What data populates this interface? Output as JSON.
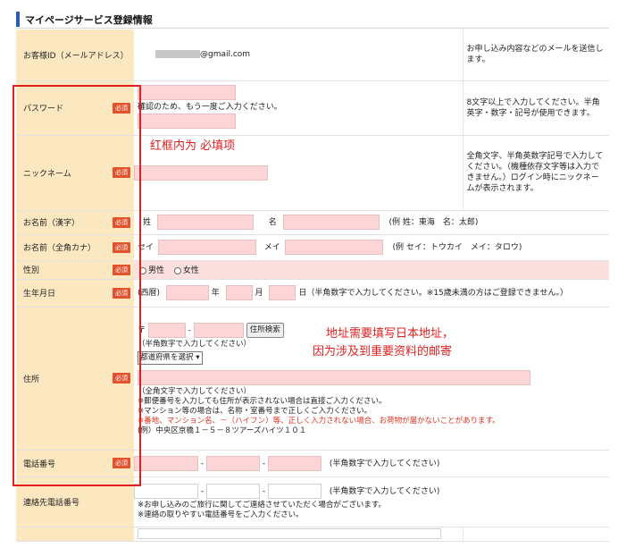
{
  "section_title": "マイページサービス登録情報",
  "required_badge": "必須",
  "rows": {
    "email": {
      "label": "お客様ID（メールアドレス）",
      "value": "@gmail.com",
      "note": "お申し込み内容などのメールを送信します。"
    },
    "password": {
      "label": "パスワード",
      "confirm_text": "確認のため、もう一度ご入力ください。",
      "note": "8文字以上で入力してください。半角英字・数字・記号が使用できます。"
    },
    "nickname": {
      "label": "ニックネーム",
      "note": "全角文字、半角英数字記号で入力してください。（機種依存文字等は入力できません。）ログイン時にニックネームが表示されます。"
    },
    "name_kanji": {
      "label": "お名前（漢字）",
      "sei": "姓",
      "mei": "名",
      "example": "(例 姓：東海　名：太郎)"
    },
    "name_kana": {
      "label": "お名前（全角カナ）",
      "sei": "セイ",
      "mei": "メイ",
      "example": "(例 セイ：トウカイ　メイ：タロウ)"
    },
    "gender": {
      "label": "性別",
      "male": "男性",
      "female": "女性"
    },
    "birthday": {
      "label": "生年月日",
      "era": "(西暦)",
      "year": "年",
      "month": "月",
      "day": "日",
      "hint": "（半角数字で入力してください。※15歳未満の方はご登録できません。）"
    },
    "address": {
      "label": "住所",
      "postal_mark": "〒",
      "dash": "-",
      "search_button": "住所検索",
      "postal_hint": "（半角数字で入力してください）",
      "pref_select": "都道府県を選択",
      "hint1": "（全角文字で入力してください）",
      "hint2": "※郵便番号を入力しても住所が表示されない場合は直接ご入力ください。",
      "hint3": "※マンション等の場合は、名称・室番号まで正しくご入力ください。",
      "hint4_red": "※番地、マンション名、－（ハイフン）等、正しく入力されない場合、お荷物が届かないことがあります。",
      "example": "(例）中央区京橋１－５－８ツアーズハイツ１０１"
    },
    "phone": {
      "label": "電話番号",
      "dash": "-",
      "hint": "(半角数字で入力してください)"
    },
    "contact_phone": {
      "label": "連絡先電話番号",
      "dash": "-",
      "hint": "(半角数字で入力してください)",
      "note1": "※お申し込みのご旅行に関してご連絡させていただく場合がございます。",
      "note2": "※連絡の取りやすい電話番号をご入力ください。"
    }
  },
  "annotations": {
    "required_note": "红框内为 必填项",
    "address_note_line1": "地址需要填写日本地址，",
    "address_note_line2": "因为涉及到重要资料的邮寄"
  },
  "colors": {
    "label_bg": "#fbe8c0",
    "required_input": "#fcd6d6",
    "annotation_red": "#e02020",
    "header_bar": "#2a5db0"
  }
}
